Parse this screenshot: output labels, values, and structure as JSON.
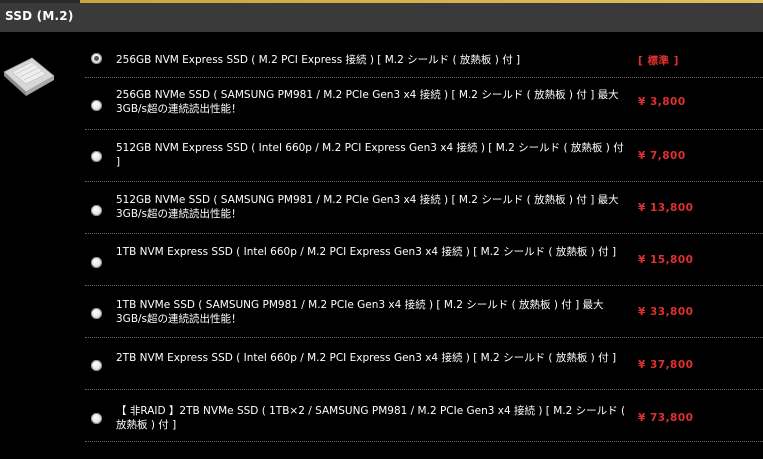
{
  "section": {
    "title": "SSD (M.2)"
  },
  "options": [
    {
      "label": "256GB NVM Express SSD ( M.2 PCI Express 接続 ) [ M.2 シールド ( 放熱板 ) 付 ]",
      "price": "[ 標準 ]",
      "selected": true
    },
    {
      "label": "256GB NVMe SSD ( SAMSUNG PM981 / M.2 PCIe Gen3 x4 接続 ) [ M.2 シールド ( 放熱板 ) 付 ] 最大3GB/s超の連続読出性能！",
      "price": "¥ 3,800",
      "selected": false
    },
    {
      "label": "512GB NVM Express SSD ( Intel 660p / M.2 PCI Express Gen3 x4 接続 ) [ M.2 シールド ( 放熱板 ) 付 ]",
      "price": "¥ 7,800",
      "selected": false
    },
    {
      "label": "512GB NVMe SSD ( SAMSUNG PM981 / M.2 PCIe Gen3 x4 接続 ) [ M.2 シールド ( 放熱板 ) 付 ] 最大3GB/s超の連続読出性能！",
      "price": "¥ 13,800",
      "selected": false
    },
    {
      "label": "1TB NVM Express SSD ( Intel 660p / M.2 PCI Express Gen3 x4 接続 ) [ M.2 シールド ( 放熱板 ) 付 ]",
      "price": "¥ 15,800",
      "selected": false
    },
    {
      "label": "1TB NVMe SSD ( SAMSUNG PM981 / M.2 PCIe Gen3 x4 接続 ) [ M.2 シールド ( 放熱板 ) 付 ] 最大3GB/s超の連続読出性能！",
      "price": "¥ 33,800",
      "selected": false
    },
    {
      "label": "2TB NVM Express SSD ( Intel 660p / M.2 PCI Express Gen3 x4 接続 ) [ M.2 シールド ( 放熱板 ) 付 ]",
      "price": "¥ 37,800",
      "selected": false
    },
    {
      "label": "【 非RAID 】2TB NVMe SSD ( 1TB×2 / SAMSUNG PM981 / M.2 PCIe Gen3 x4 接続 ) [ M.2 シールド ( 放熱板 ) 付 ]",
      "price": "¥ 73,800",
      "selected": false
    }
  ],
  "colors": {
    "price": "#e03030",
    "header_bg": "#3a3a3a",
    "accent": "#c9a53a"
  }
}
